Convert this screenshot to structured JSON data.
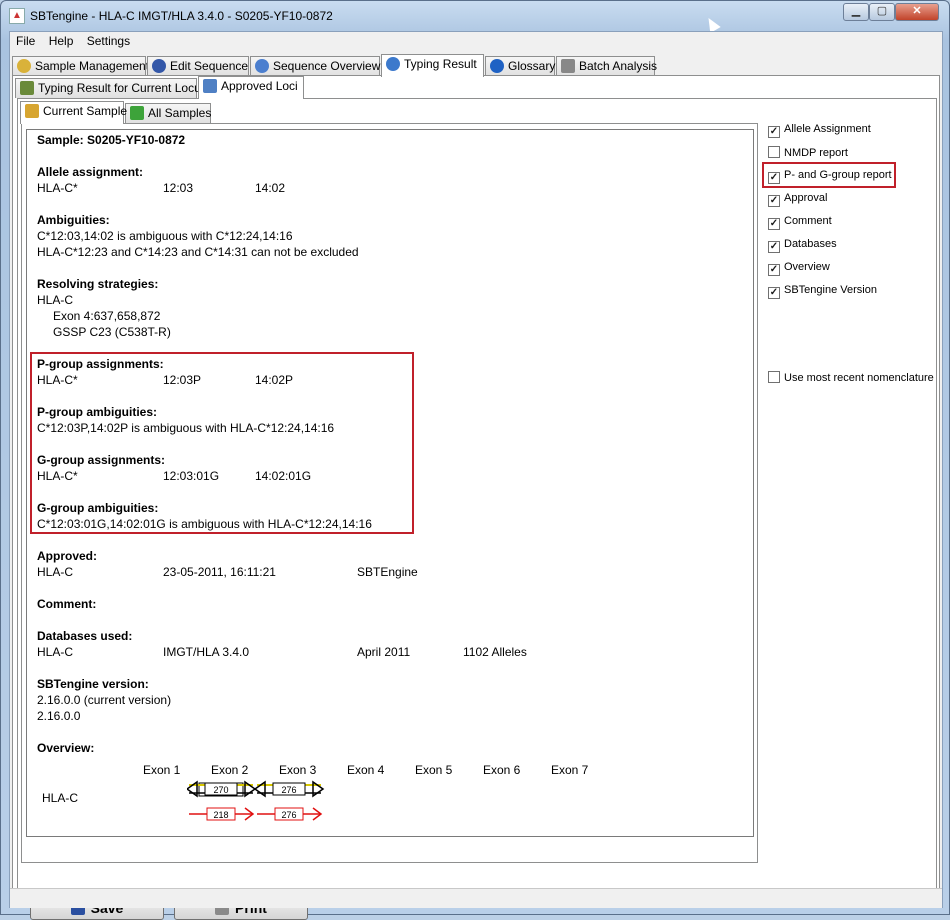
{
  "window": {
    "title": "SBTengine - HLA-C IMGT/HLA 3.4.0 - S0205-YF10-0872"
  },
  "menu": [
    "File",
    "Help",
    "Settings"
  ],
  "main_tabs": [
    {
      "label": "Sample Management",
      "icon": "sample-management-icon"
    },
    {
      "label": "Edit Sequence",
      "icon": "edit-sequence-icon"
    },
    {
      "label": "Sequence Overview",
      "icon": "sequence-overview-icon"
    },
    {
      "label": "Typing Result",
      "icon": "typing-result-icon"
    },
    {
      "label": "Glossary",
      "icon": "glossary-icon"
    },
    {
      "label": "Batch Analysis",
      "icon": "batch-analysis-icon"
    }
  ],
  "sub_tabs": [
    {
      "label": "Typing Result for Current Locus"
    },
    {
      "label": "Approved Loci"
    }
  ],
  "sample_tabs": [
    {
      "label": "Current Sample"
    },
    {
      "label": "All Samples"
    }
  ],
  "report": {
    "sample": "Sample:  S0205-YF10-0872",
    "allele_title": "Allele assignment:",
    "allele_locus": "HLA-C*",
    "allele_1": "12:03",
    "allele_2": "14:02",
    "amb_title": "Ambiguities:",
    "amb_1": "C*12:03,14:02 is ambiguous with C*12:24,14:16",
    "amb_2": "HLA-C*12:23 and C*14:23 and C*14:31 can not be excluded",
    "res_title": "Resolving strategies:",
    "res_locus": "HLA-C",
    "res_1": "Exon 4:637,658,872",
    "res_2": "GSSP C23 (C538T-R)",
    "pg_title": "P-group assignments:",
    "pg_locus": "HLA-C*",
    "pg_1": "12:03P",
    "pg_2": "14:02P",
    "pga_title": "P-group ambiguities:",
    "pga_1": "C*12:03P,14:02P is ambiguous with HLA-C*12:24,14:16",
    "gg_title": "G-group assignments:",
    "gg_locus": "HLA-C*",
    "gg_1": "12:03:01G",
    "gg_2": "14:02:01G",
    "gga_title": "G-group ambiguities:",
    "gga_1": "C*12:03:01G,14:02:01G is ambiguous with HLA-C*12:24,14:16",
    "appr_title": "Approved:",
    "appr_locus": "HLA-C",
    "appr_date": "23-05-2011, 16:11:21",
    "appr_by": "SBTEngine",
    "comment_title": "Comment:",
    "db_title": "Databases used:",
    "db_locus": "HLA-C",
    "db_name": "IMGT/HLA 3.4.0",
    "db_date": "April 2011",
    "db_alleles": "1102 Alleles",
    "ver_title": "SBTengine version:",
    "ver_1": "2.16.0.0 (current version)",
    "ver_2": "2.16.0.0",
    "ov_title": "Overview:",
    "ov_locus": "HLA-C",
    "exons": [
      "Exon 1",
      "Exon 2",
      "Exon 3",
      "Exon 4",
      "Exon 5",
      "Exon 6",
      "Exon 7"
    ],
    "fwd": [
      "270",
      "276"
    ],
    "rev": [
      "218",
      "276"
    ]
  },
  "buttons": {
    "save": "Save",
    "print": "Print"
  },
  "options": [
    {
      "label": "Allele Assignment",
      "checked": true
    },
    {
      "label": "NMDP report",
      "checked": false
    },
    {
      "label": "P- and G-group report",
      "checked": true
    },
    {
      "label": "Approval",
      "checked": true
    },
    {
      "label": "Comment",
      "checked": true
    },
    {
      "label": "Databases",
      "checked": true
    },
    {
      "label": "Overview",
      "checked": true
    },
    {
      "label": "SBTengine Version",
      "checked": true
    },
    {
      "label": "Use most recent nomenclature",
      "checked": false
    }
  ]
}
